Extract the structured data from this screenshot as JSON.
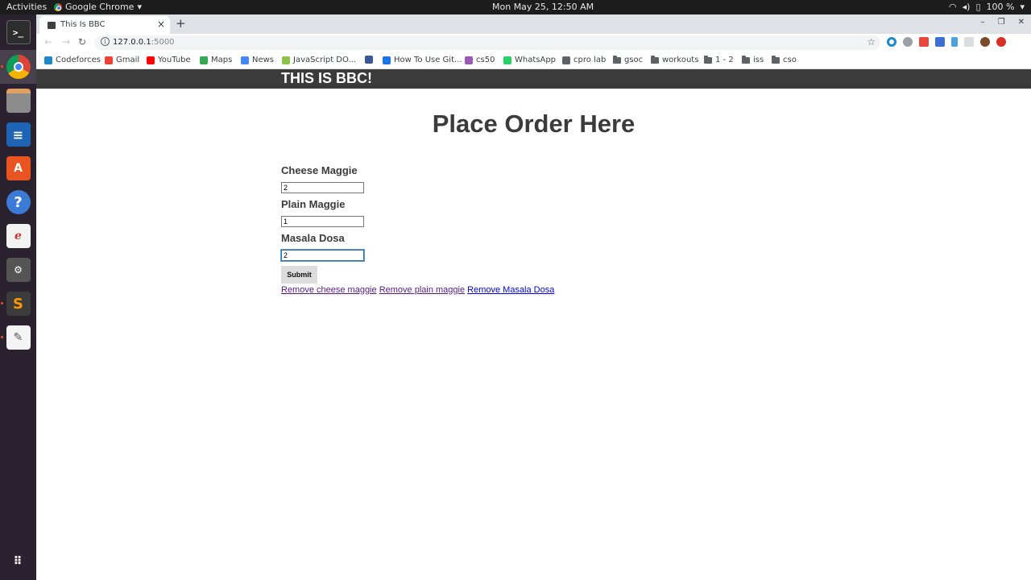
{
  "system": {
    "activities": "Activities",
    "app_name": "Google Chrome",
    "clock": "Mon May 25, 12:50 AM",
    "battery": "100 %"
  },
  "browser": {
    "tab_title": "This Is BBC",
    "url_host": "127.0.0.1",
    "url_port": ":5000"
  },
  "bookmarks": [
    {
      "label": "Codeforces",
      "color": "#1f8acb"
    },
    {
      "label": "Gmail",
      "color": "#ea4335"
    },
    {
      "label": "YouTube",
      "color": "#ff0000"
    },
    {
      "label": "Maps",
      "color": "#34a853"
    },
    {
      "label": "News",
      "color": "#4285f4"
    },
    {
      "label": "JavaScript DO...",
      "color": "#8bc34a"
    },
    {
      "label": "",
      "color": "#3b5998"
    },
    {
      "label": "How To Use Git...",
      "color": "#1a73e8"
    },
    {
      "label": "cs50",
      "color": "#9b59b6"
    },
    {
      "label": "WhatsApp",
      "color": "#25d366"
    },
    {
      "label": "cpro lab",
      "color": "#5f6368"
    },
    {
      "label": "gsoc",
      "color": "folder"
    },
    {
      "label": "workouts",
      "color": "folder"
    },
    {
      "label": "1 - 2",
      "color": "folder"
    },
    {
      "label": "iss",
      "color": "folder"
    },
    {
      "label": "cso",
      "color": "folder"
    }
  ],
  "site": {
    "brand": "THIS IS BBC!",
    "heading": "Place Order Here"
  },
  "form": {
    "fields": [
      {
        "label": "Cheese Maggie",
        "value": "2"
      },
      {
        "label": "Plain Maggie",
        "value": "1"
      },
      {
        "label": "Masala Dosa",
        "value": "2"
      }
    ],
    "submit_label": "Submit"
  },
  "links": [
    {
      "label": "Remove cheese maggie",
      "visited": true
    },
    {
      "label": "Remove plain maggie",
      "visited": true
    },
    {
      "label": "Remove Masala Dosa",
      "visited": false
    }
  ]
}
